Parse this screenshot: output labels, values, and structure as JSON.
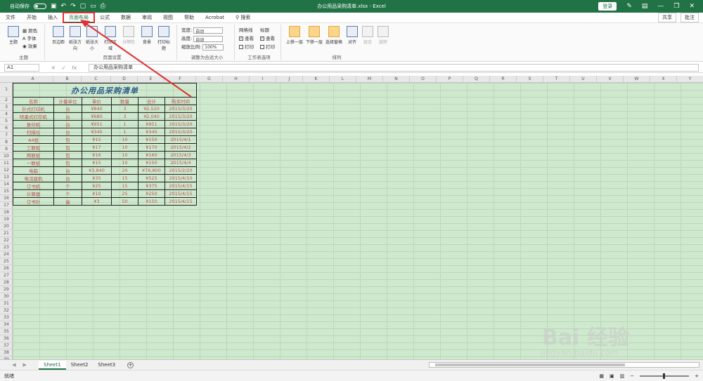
{
  "window": {
    "autosave_label": "自动保存",
    "autosave_state": "关",
    "title": "办公用品采购清单.xlsx - Excel",
    "login_label": "登录"
  },
  "menu": {
    "tabs": [
      "文件",
      "开始",
      "插入",
      "页面布局",
      "公式",
      "数据",
      "审阅",
      "视图",
      "帮助",
      "Acrobat"
    ],
    "active_index": 3,
    "search_label": "搜索",
    "share_label": "共享",
    "comment_label": "批注"
  },
  "ribbon": {
    "theme_group": {
      "label": "主题",
      "themes": "主题",
      "colors": "颜色",
      "fonts": "字体",
      "effects": "效果"
    },
    "page_setup_group": {
      "label": "页面设置",
      "items": [
        "页边距",
        "纸张方向",
        "纸张大小",
        "打印区域",
        "分隔符",
        "背景",
        "打印标题"
      ]
    },
    "scale_group": {
      "label": "调整为合适大小",
      "width_label": "宽度:",
      "width_value": "自动",
      "height_label": "高度:",
      "height_value": "自动",
      "scale_label": "缩放比例:",
      "scale_value": "100%"
    },
    "sheet_options_group": {
      "label": "工作表选项",
      "gridlines": "网格线",
      "headings": "标题",
      "view": "查看",
      "print": "打印"
    },
    "arrange_group": {
      "label": "排列",
      "items": [
        "上移一层",
        "下移一层",
        "选择窗格",
        "对齐",
        "组合",
        "旋转"
      ]
    }
  },
  "formula_bar": {
    "cell_ref": "A1",
    "content": "办公用品采购清单",
    "fx": "fx"
  },
  "columns": [
    "A",
    "B",
    "C",
    "D",
    "E",
    "F",
    "G",
    "H",
    "I",
    "J",
    "K",
    "L",
    "M",
    "N",
    "O",
    "P",
    "Q",
    "R",
    "S",
    "T",
    "U",
    "V",
    "W",
    "X",
    "Y"
  ],
  "row_count": 39,
  "table": {
    "title": "办公用品采购清单",
    "headers": [
      "名称",
      "计量单位",
      "单价",
      "数量",
      "合计",
      "购买时间"
    ],
    "rows": [
      [
        "针式打印机",
        "台",
        "¥840",
        "3",
        "¥2,520",
        "2015/3/20"
      ],
      [
        "喷墨式打印机",
        "台",
        "¥680",
        "3",
        "¥2,040",
        "2015/3/20"
      ],
      [
        "复印机",
        "台",
        "¥951",
        "1",
        "¥951",
        "2015/3/20"
      ],
      [
        "扫描仪",
        "台",
        "¥345",
        "1",
        "¥345",
        "2015/3/20"
      ],
      [
        "A4纸",
        "包",
        "¥15",
        "10",
        "¥150",
        "2015/4/1"
      ],
      [
        "三联纸",
        "包",
        "¥17",
        "10",
        "¥170",
        "2015/4/2"
      ],
      [
        "两联纸",
        "包",
        "¥16",
        "10",
        "¥160",
        "2015/4/3"
      ],
      [
        "一联纸",
        "包",
        "¥15",
        "10",
        "¥150",
        "2015/4/4"
      ],
      [
        "电脑",
        "台",
        "¥3,840",
        "20",
        "¥76,800",
        "2015/2/20"
      ],
      [
        "电话座机",
        "台",
        "¥35",
        "15",
        "¥525",
        "2015/4/10"
      ],
      [
        "订书机",
        "个",
        "¥25",
        "15",
        "¥375",
        "2015/4/15"
      ],
      [
        "计算器",
        "个",
        "¥10",
        "25",
        "¥250",
        "2015/4/15"
      ],
      [
        "订书针",
        "盒",
        "¥3",
        "50",
        "¥150",
        "2015/4/15"
      ]
    ]
  },
  "sheets": {
    "tabs": [
      "Sheet1",
      "Sheet2",
      "Sheet3"
    ],
    "active_index": 0
  },
  "status": {
    "ready": "就绪"
  },
  "watermark": {
    "brand": "Bai 经验",
    "url": "jingyan.baidu.com"
  },
  "colors": {
    "excel_green": "#217346",
    "cell_text": "#c0504d",
    "title_text": "#2e5c8a",
    "sheet_bg": "#cfe9cf",
    "annotation_red": "#e03030"
  }
}
